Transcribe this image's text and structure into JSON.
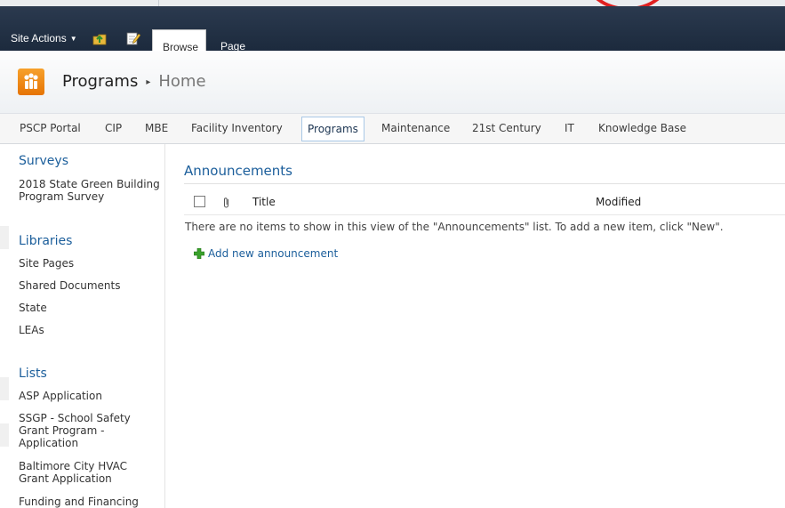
{
  "ribbon": {
    "site_actions": "Site Actions",
    "tabs": [
      "Browse",
      "Page"
    ]
  },
  "icons": {
    "navigate_up": "navigate-up-icon",
    "edit_page": "edit-page-icon",
    "site_logo": "people-logo-icon",
    "attachment": "paperclip-icon",
    "add": "plus-icon"
  },
  "breadcrumb": {
    "site": "Programs",
    "separator": "▸",
    "page": "Home"
  },
  "topnav": [
    "PSCP Portal",
    "CIP",
    "MBE",
    "Facility Inventory",
    "Programs",
    "Maintenance",
    "21st Century",
    "IT",
    "Knowledge Base"
  ],
  "topnav_selected": "Programs",
  "leftnav": {
    "surveys": {
      "heading": "Surveys",
      "items": [
        "2018 State Green Building Program Survey"
      ]
    },
    "libraries": {
      "heading": "Libraries",
      "items": [
        "Site Pages",
        "Shared Documents",
        "State",
        "LEAs"
      ]
    },
    "lists": {
      "heading": "Lists",
      "items": [
        "ASP Application",
        "SSGP - School Safety Grant Program - Application",
        "Baltimore City HVAC Grant Application",
        "Funding and Financing"
      ]
    }
  },
  "announcements": {
    "title": "Announcements",
    "columns": [
      "Title",
      "Modified"
    ],
    "empty_message": "There are no items to show in this view of the \"Announcements\" list. To add a new item, click \"New\".",
    "add_link": "Add new announcement"
  },
  "colors": {
    "ribbon_bg": "#1c2a3d",
    "link_blue": "#1b5e9b",
    "logo_orange": "#f28a16",
    "add_green": "#3aa12c",
    "annotation_red": "#e02020"
  }
}
